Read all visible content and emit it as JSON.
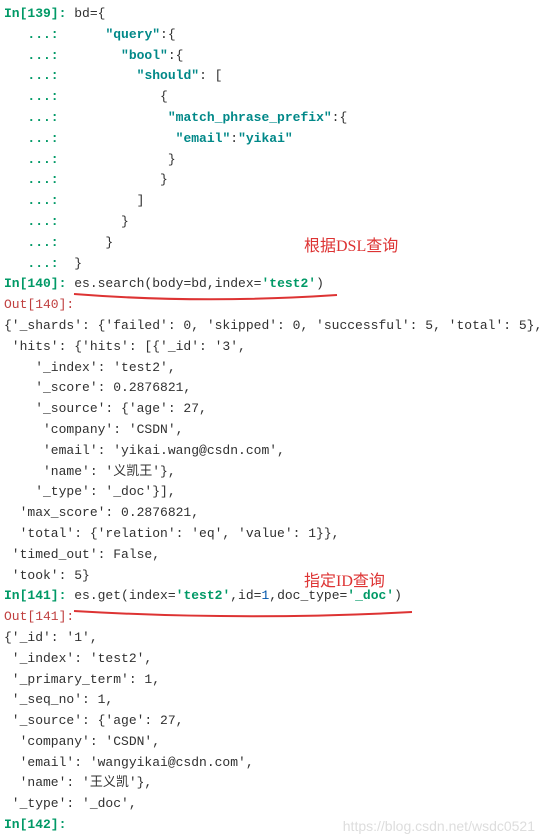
{
  "prompts": {
    "in139": "In[139]:",
    "in140": "In[140]:",
    "in141": "In[141]:",
    "in142": "In[142]:",
    "out140": "Out[140]:",
    "out141": "Out[141]:",
    "cont": "   ...: "
  },
  "code139": {
    "l1": " bd={",
    "l2a": "     ",
    "l2b": "\"query\"",
    "l2c": ":{",
    "l3a": "       ",
    "l3b": "\"bool\"",
    "l3c": ":{",
    "l4a": "         ",
    "l4b": "\"should\"",
    "l4c": ": [",
    "l5": "            {",
    "l6a": "             ",
    "l6b": "\"match_phrase_prefix\"",
    "l6c": ":{",
    "l7a": "              ",
    "l7b": "\"email\"",
    "l7c": ":",
    "l7d": "\"yikai\"",
    "l8": "             }",
    "l9": "            }",
    "l10": "         ]",
    "l11": "       }",
    "l12": "     }",
    "l13": " }"
  },
  "code140": {
    "l1a": " es.search(body=bd,index=",
    "l1b": "'test2'",
    "l1c": ")"
  },
  "code141": {
    "l1a": " es.get(index=",
    "l1b": "'test2'",
    "l1c": ",id=",
    "l1d": "1",
    "l1e": ",doc_type=",
    "l1f": "'_doc'",
    "l1g": ")"
  },
  "out140data": {
    "l1": "{'_shards': {'failed': 0, 'skipped': 0, 'successful': 5, 'total': 5},",
    "l2": " 'hits': {'hits': [{'_id': '3',",
    "l3": "    '_index': 'test2',",
    "l4": "    '_score': 0.2876821,",
    "l5": "    '_source': {'age': 27,",
    "l6": "     'company': 'CSDN',",
    "l7": "     'email': 'yikai.wang@csdn.com',",
    "l8": "     'name': '义凯王'},",
    "l9": "    '_type': '_doc'}],",
    "l10": "  'max_score': 0.2876821,",
    "l11": "  'total': {'relation': 'eq', 'value': 1}},",
    "l12": " 'timed_out': False,",
    "l13": " 'took': 5}"
  },
  "out141data": {
    "l1": "{'_id': '1',",
    "l2": " '_index': 'test2',",
    "l3": " '_primary_term': 1,",
    "l4": " '_seq_no': 1,",
    "l5": " '_source': {'age': 27,",
    "l6": "  'company': 'CSDN',",
    "l7": "  'email': 'wangyikai@csdn.com',",
    "l8": "  'name': '王义凯'},",
    "l9": " '_type': '_doc',"
  },
  "annotations": {
    "dsl": "根据DSL查询",
    "id": "指定ID查询"
  },
  "watermark": "https://blog.csdn.net/wsdc0521"
}
